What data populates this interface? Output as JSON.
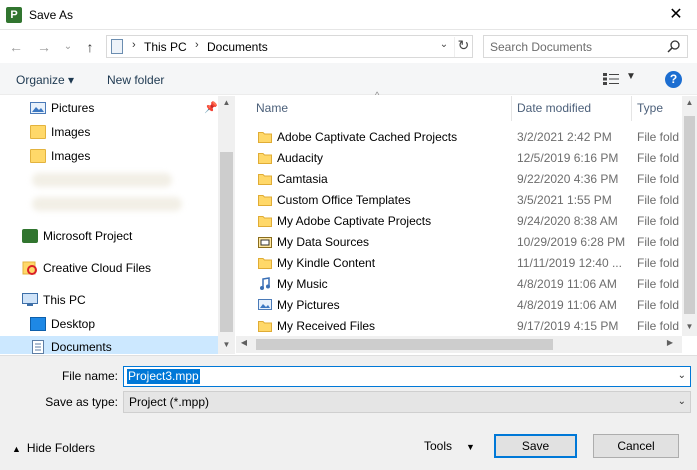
{
  "window": {
    "title": "Save As",
    "app_icon_letter": "P"
  },
  "nav": {
    "back": "←",
    "forward": "→",
    "recent": "⌄",
    "up": "↑"
  },
  "address": {
    "crumbs": [
      "This PC",
      "Documents"
    ]
  },
  "search": {
    "placeholder": "Search Documents"
  },
  "commands": {
    "organize": "Organize ▾",
    "new_folder": "New folder"
  },
  "sidebar": {
    "items": [
      {
        "label": "Pictures"
      },
      {
        "label": "Images"
      },
      {
        "label": "Images"
      },
      {
        "label": "Microsoft Project"
      },
      {
        "label": "Creative Cloud Files"
      },
      {
        "label": "This PC"
      },
      {
        "label": "Desktop"
      },
      {
        "label": "Documents"
      }
    ]
  },
  "columns": {
    "name": "Name",
    "date": "Date modified",
    "type": "Type"
  },
  "files": [
    {
      "name": "Adobe Captivate Cached Projects",
      "date": "3/2/2021 2:42 PM",
      "type": "File fold",
      "icon": "folder-icon"
    },
    {
      "name": "Audacity",
      "date": "12/5/2019 6:16 PM",
      "type": "File fold",
      "icon": "folder-icon"
    },
    {
      "name": "Camtasia",
      "date": "9/22/2020 4:36 PM",
      "type": "File fold",
      "icon": "folder-icon"
    },
    {
      "name": "Custom Office Templates",
      "date": "3/5/2021 1:55 PM",
      "type": "File fold",
      "icon": "folder-icon"
    },
    {
      "name": "My Adobe Captivate Projects",
      "date": "9/24/2020 8:38 AM",
      "type": "File fold",
      "icon": "folder-icon"
    },
    {
      "name": "My Data Sources",
      "date": "10/29/2019 6:28 PM",
      "type": "File fold",
      "icon": "data-sources-icon"
    },
    {
      "name": "My Kindle Content",
      "date": "11/11/2019 12:40 ...",
      "type": "File fold",
      "icon": "folder-icon"
    },
    {
      "name": "My Music",
      "date": "4/8/2019 11:06 AM",
      "type": "File fold",
      "icon": "music-folder-icon"
    },
    {
      "name": "My Pictures",
      "date": "4/8/2019 11:06 AM",
      "type": "File fold",
      "icon": "pictures-folder-icon"
    },
    {
      "name": "My Received Files",
      "date": "9/17/2019 4:15 PM",
      "type": "File fold",
      "icon": "folder-icon"
    }
  ],
  "form": {
    "file_name_label": "File name:",
    "file_name_value": "Project3.mpp",
    "save_type_label": "Save as type:",
    "save_type_value": "Project (*.mpp)"
  },
  "footer": {
    "hide_folders": "Hide Folders",
    "tools": "Tools",
    "save": "Save",
    "cancel": "Cancel"
  },
  "colors": {
    "accent": "#0078d7",
    "selection": "#cce8ff",
    "folder": "#ffd869"
  }
}
